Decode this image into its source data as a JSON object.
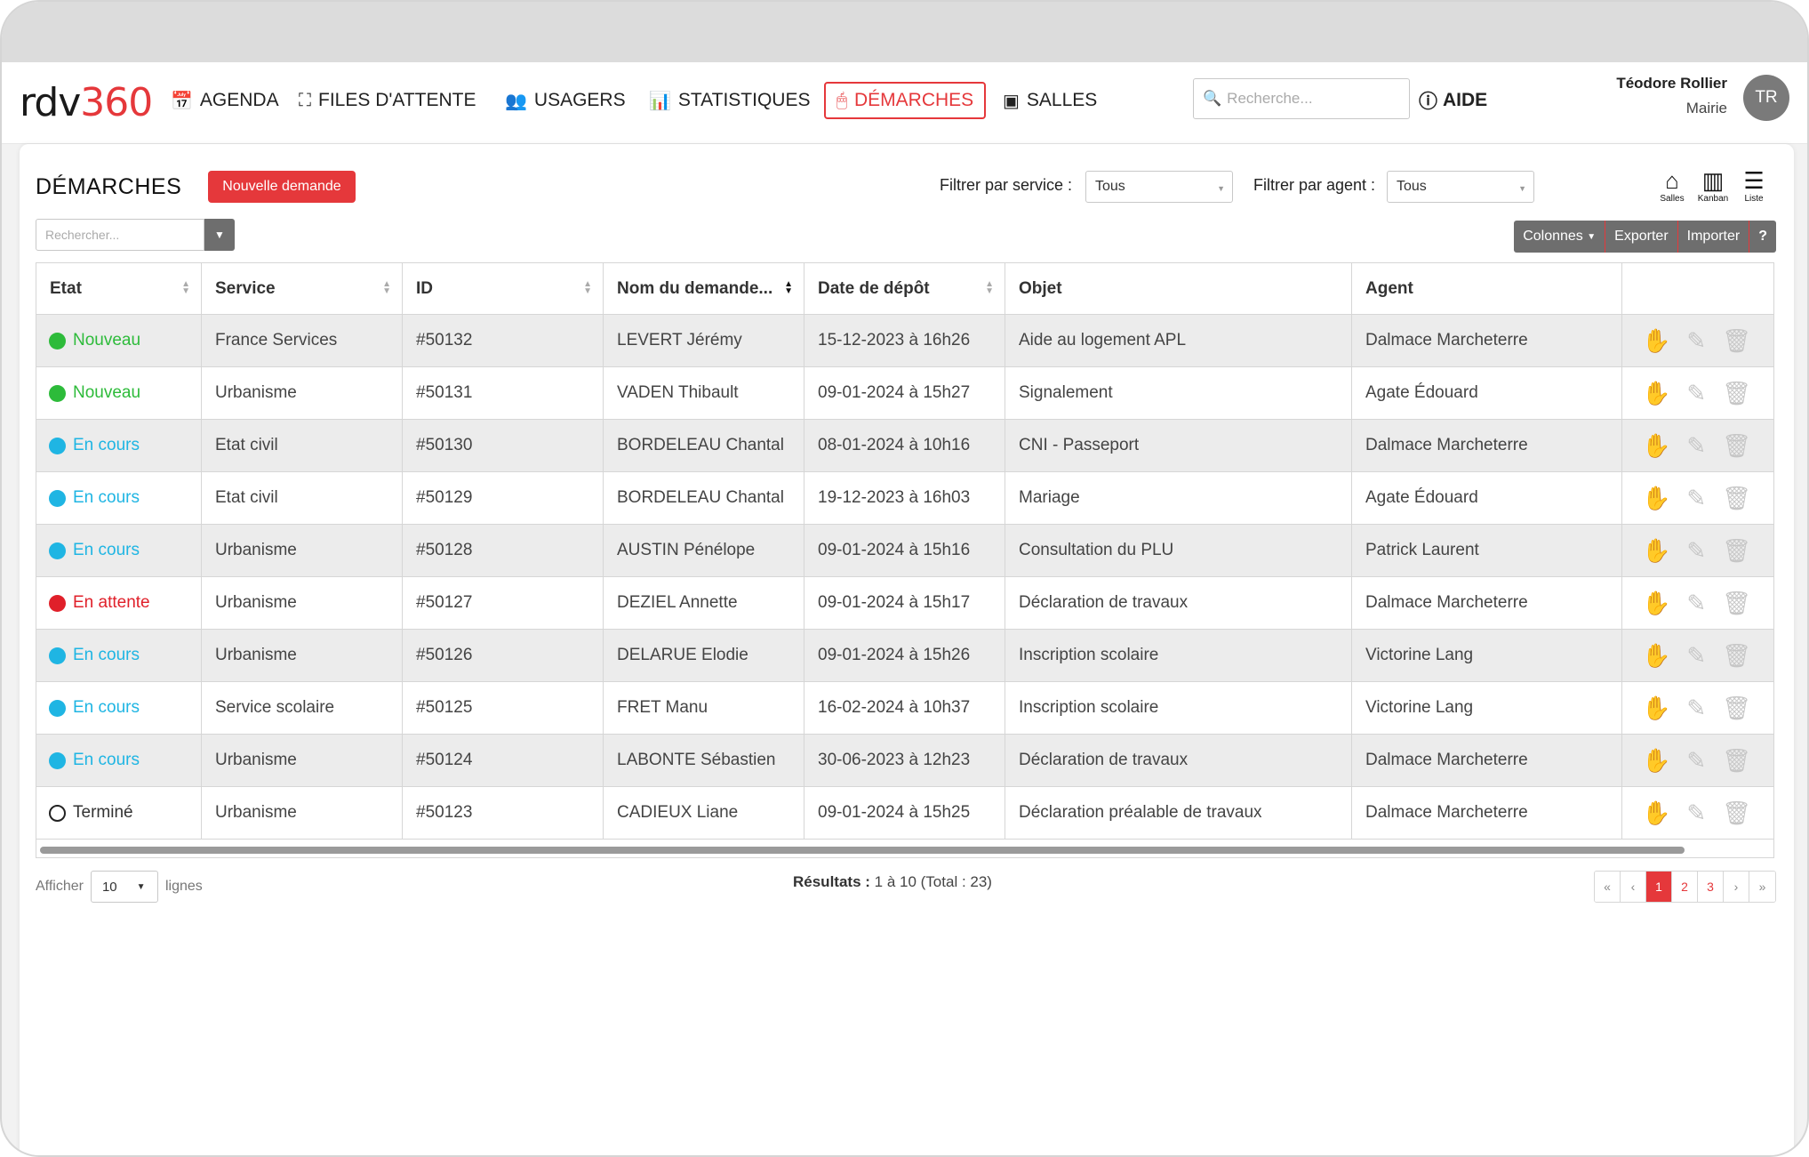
{
  "app": {
    "logo_a": "rdv",
    "logo_b": "360",
    "nav": [
      {
        "label": "AGENDA",
        "icon": "calendar-icon",
        "glyph": "📅"
      },
      {
        "label": "FILES D'ATTENTE",
        "icon": "queue-icon",
        "glyph": "⛶"
      },
      {
        "label": "USAGERS",
        "icon": "users-icon",
        "glyph": "👥"
      },
      {
        "label": "STATISTIQUES",
        "icon": "chart-icon",
        "glyph": "📊"
      },
      {
        "label": "DÉMARCHES",
        "icon": "mouse-icon",
        "glyph": "🖱",
        "active": true
      },
      {
        "label": "SALLES",
        "icon": "room-icon",
        "glyph": "▣"
      }
    ],
    "search_placeholder": "Recherche...",
    "help_label": "AIDE",
    "user": {
      "name": "Téodore Rollier",
      "role": "Mairie",
      "initials": "TR"
    },
    "accent": "#e5383b"
  },
  "page": {
    "title": "DÉMARCHES",
    "new_button": "Nouvelle demande",
    "filter_service_label": "Filtrer par service :",
    "filter_service_value": "Tous",
    "filter_agent_label": "Filtrer par agent :",
    "filter_agent_value": "Tous",
    "views": [
      {
        "label": "Salles",
        "icon": "room-view-icon",
        "glyph": "⌂"
      },
      {
        "label": "Kanban",
        "icon": "kanban-view-icon",
        "glyph": "▥"
      },
      {
        "label": "Liste",
        "icon": "list-view-icon",
        "glyph": "☰"
      }
    ],
    "table_search_placeholder": "Rechercher...",
    "toolbar": {
      "columns": "Colonnes",
      "export": "Exporter",
      "import": "Importer",
      "help": "?"
    }
  },
  "table": {
    "columns": [
      "Etat",
      "Service",
      "ID",
      "Nom du demande...",
      "Date de dépôt",
      "Objet",
      "Agent"
    ],
    "status_colors": {
      "Nouveau": "#2dbb3a",
      "En cours": "#1fb5e3",
      "En attente": "#e0202a",
      "Terminé": "#222222"
    },
    "rows": [
      {
        "etat": "Nouveau",
        "service": "France Services",
        "id": "#50132",
        "nom": "LEVERT Jérémy",
        "date": "15-12-2023 à 16h26",
        "objet": "Aide au logement APL",
        "agent": "Dalmace Marcheterre"
      },
      {
        "etat": "Nouveau",
        "service": "Urbanisme",
        "id": "#50131",
        "nom": "VADEN Thibault",
        "date": "09-01-2024 à 15h27",
        "objet": "Signalement",
        "agent": "Agate Édouard"
      },
      {
        "etat": "En cours",
        "service": "Etat civil",
        "id": "#50130",
        "nom": "BORDELEAU Chantal",
        "date": "08-01-2024 à 10h16",
        "objet": "CNI - Passeport",
        "agent": "Dalmace Marcheterre"
      },
      {
        "etat": "En cours",
        "service": "Etat civil",
        "id": "#50129",
        "nom": "BORDELEAU Chantal",
        "date": "19-12-2023 à 16h03",
        "objet": "Mariage",
        "agent": "Agate Édouard"
      },
      {
        "etat": "En cours",
        "service": "Urbanisme",
        "id": "#50128",
        "nom": "AUSTIN Pénélope",
        "date": "09-01-2024 à 15h16",
        "objet": "Consultation du PLU",
        "agent": "Patrick Laurent"
      },
      {
        "etat": "En attente",
        "service": "Urbanisme",
        "id": "#50127",
        "nom": "DEZIEL Annette",
        "date": "09-01-2024 à 15h17",
        "objet": "Déclaration de travaux",
        "agent": "Dalmace Marcheterre"
      },
      {
        "etat": "En cours",
        "service": "Urbanisme",
        "id": "#50126",
        "nom": "DELARUE Elodie",
        "date": "09-01-2024 à 15h26",
        "objet": "Inscription scolaire",
        "agent": "Victorine Lang"
      },
      {
        "etat": "En cours",
        "service": "Service scolaire",
        "id": "#50125",
        "nom": "FRET Manu",
        "date": "16-02-2024 à 10h37",
        "objet": "Inscription scolaire",
        "agent": "Victorine Lang"
      },
      {
        "etat": "En cours",
        "service": "Urbanisme",
        "id": "#50124",
        "nom": "LABONTE Sébastien",
        "date": "30-06-2023 à 12h23",
        "objet": "Déclaration de travaux",
        "agent": "Dalmace Marcheterre"
      },
      {
        "etat": "Terminé",
        "service": "Urbanisme",
        "id": "#50123",
        "nom": "CADIEUX Liane",
        "date": "09-01-2024 à 15h25",
        "objet": "Déclaration préalable de travaux",
        "agent": "Dalmace Marcheterre"
      }
    ]
  },
  "footer": {
    "show_label": "Afficher",
    "show_value": "10",
    "lines_label": "lignes",
    "results_label": "Résultats :",
    "results_value": "1 à 10 (Total : 23)",
    "pages": [
      "«",
      "‹",
      "1",
      "2",
      "3",
      "›",
      "»"
    ],
    "current_page": "1"
  }
}
